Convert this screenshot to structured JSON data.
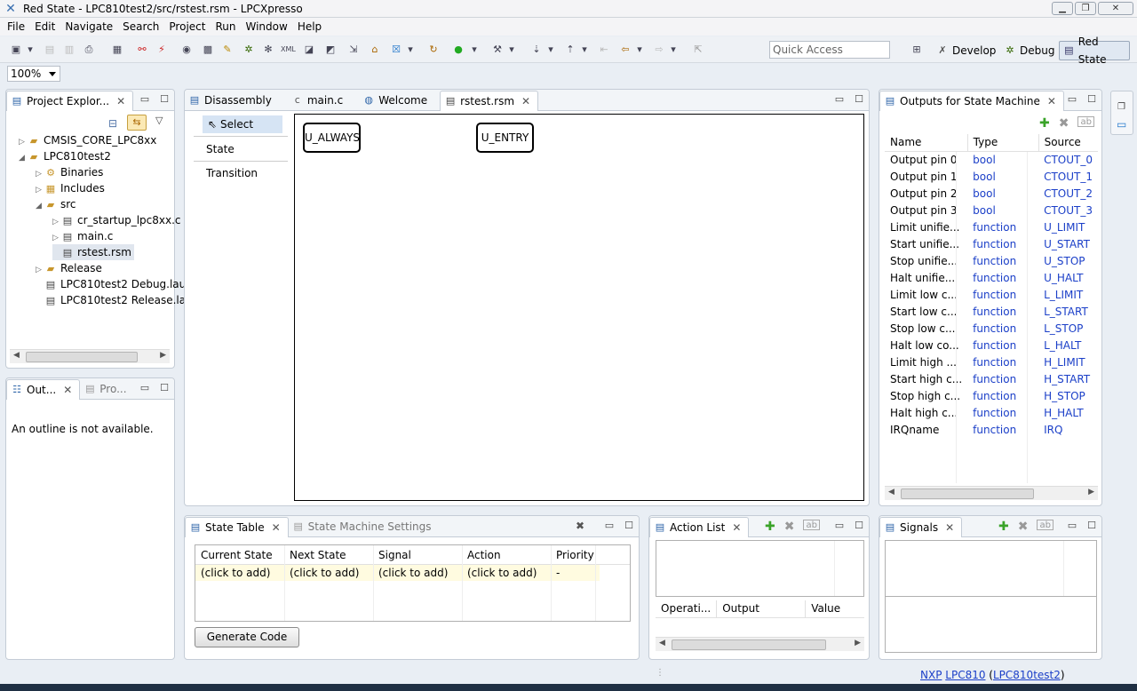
{
  "window": {
    "title": "Red State - LPC810test2/src/rstest.rsm - LPCXpresso"
  },
  "menu": [
    "File",
    "Edit",
    "Navigate",
    "Search",
    "Project",
    "Run",
    "Window",
    "Help"
  ],
  "toolbar": {
    "quick_access": "Quick Access",
    "perspectives": [
      "Develop",
      "Debug",
      "Red State"
    ],
    "zoom": "100%"
  },
  "project_explorer": {
    "tab": "Project Explor...",
    "items": [
      {
        "label": "CMSIS_CORE_LPC8xx",
        "indent": 0,
        "arrow": "▷"
      },
      {
        "label": "LPC810test2",
        "indent": 0,
        "arrow": "◢"
      },
      {
        "label": "Binaries",
        "indent": 1,
        "arrow": "▷"
      },
      {
        "label": "Includes",
        "indent": 1,
        "arrow": "▷"
      },
      {
        "label": "src",
        "indent": 1,
        "arrow": "◢"
      },
      {
        "label": "cr_startup_lpc8xx.c",
        "indent": 2,
        "arrow": "▷"
      },
      {
        "label": "main.c",
        "indent": 2,
        "arrow": "▷"
      },
      {
        "label": "rstest.rsm",
        "indent": 2,
        "arrow": ""
      },
      {
        "label": "Release",
        "indent": 1,
        "arrow": "▷"
      },
      {
        "label": "LPC810test2 Debug.lau",
        "indent": 1,
        "arrow": ""
      },
      {
        "label": "LPC810test2 Release.la",
        "indent": 1,
        "arrow": ""
      }
    ]
  },
  "outline": {
    "tab1": "Out...",
    "tab2": "Pro...",
    "message": "An outline is not available."
  },
  "editor": {
    "tabs": [
      "Disassembly",
      "main.c",
      "Welcome",
      "rstest.rsm"
    ],
    "palette": [
      "Select",
      "State",
      "Transition"
    ],
    "states": [
      "U_ALWAYS",
      "U_ENTRY"
    ]
  },
  "outputs": {
    "tab": "Outputs for State Machine",
    "columns": [
      "Name",
      "Type",
      "Source"
    ],
    "rows": [
      [
        "Output pin 0",
        "bool",
        "CTOUT_0"
      ],
      [
        "Output pin 1",
        "bool",
        "CTOUT_1"
      ],
      [
        "Output pin 2",
        "bool",
        "CTOUT_2"
      ],
      [
        "Output pin 3",
        "bool",
        "CTOUT_3"
      ],
      [
        "Limit unifie...",
        "function",
        "U_LIMIT"
      ],
      [
        "Start unifie...",
        "function",
        "U_START"
      ],
      [
        "Stop unifie...",
        "function",
        "U_STOP"
      ],
      [
        "Halt unifie...",
        "function",
        "U_HALT"
      ],
      [
        "Limit low c...",
        "function",
        "L_LIMIT"
      ],
      [
        "Start low c...",
        "function",
        "L_START"
      ],
      [
        "Stop low c...",
        "function",
        "L_STOP"
      ],
      [
        "Halt low co...",
        "function",
        "L_HALT"
      ],
      [
        "Limit high ...",
        "function",
        "H_LIMIT"
      ],
      [
        "Start high c...",
        "function",
        "H_START"
      ],
      [
        "Stop high c...",
        "function",
        "H_STOP"
      ],
      [
        "Halt high c...",
        "function",
        "H_HALT"
      ],
      [
        "IRQname",
        "function",
        "IRQ"
      ]
    ]
  },
  "state_table": {
    "tab": "State Table",
    "tab2": "State Machine Settings",
    "columns": [
      "Current State",
      "Next State",
      "Signal",
      "Action",
      "Priority"
    ],
    "row": [
      "(click to add)",
      "(click to add)",
      "(click to add)",
      "(click to add)",
      "-"
    ],
    "generate": "Generate Code"
  },
  "action_list": {
    "tab": "Action List",
    "columns": [
      "Operati...",
      "Output",
      "Value"
    ]
  },
  "signals": {
    "tab": "Signals"
  },
  "status": {
    "nxp": "NXP",
    "chip": "LPC810",
    "project": "LPC810test2"
  }
}
